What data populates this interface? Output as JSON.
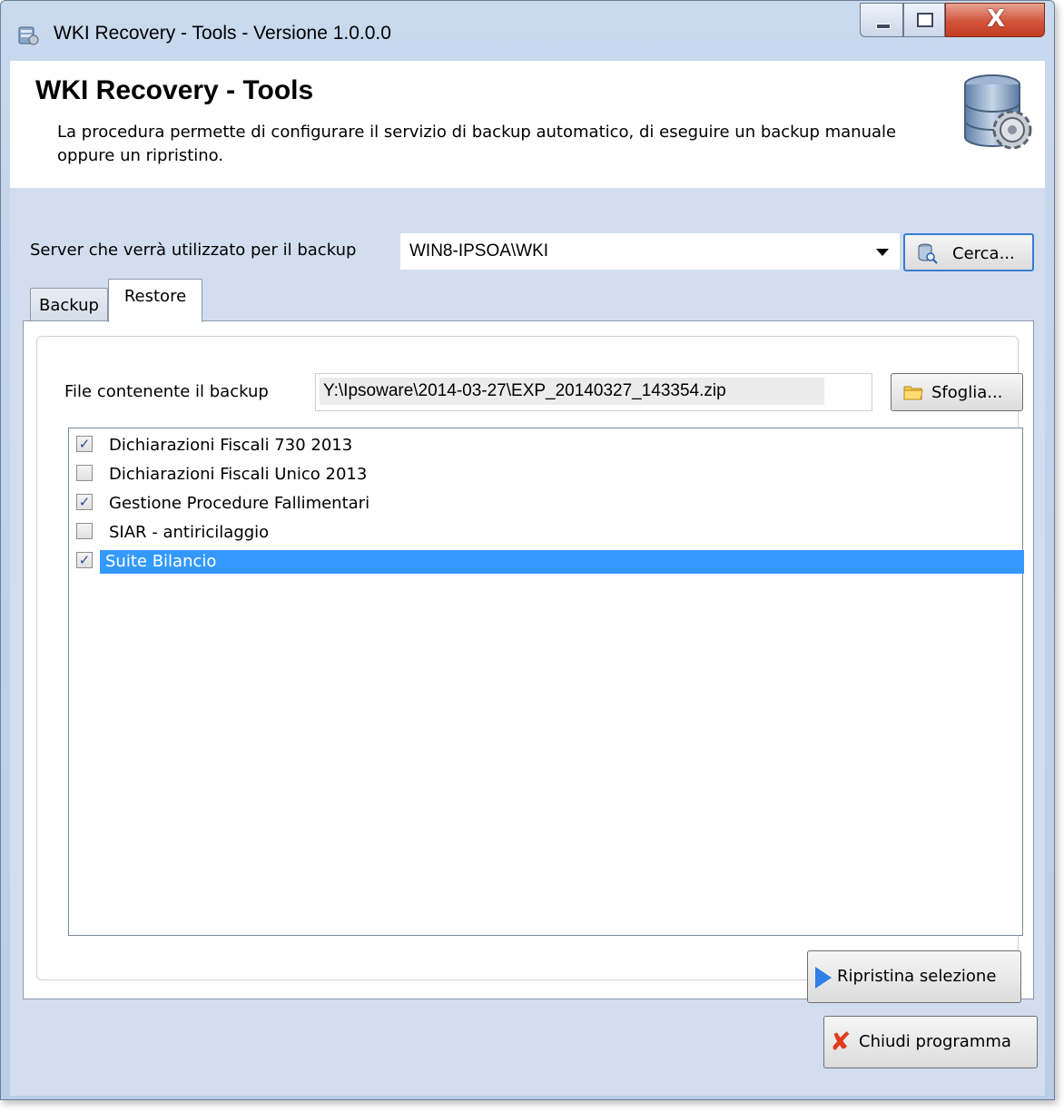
{
  "window": {
    "title": "WKI Recovery - Tools - Versione 1.0.0.0",
    "close_glyph": "X"
  },
  "header": {
    "title": "WKI Recovery - Tools",
    "description": "La procedura permette di configurare il servizio di backup automatico, di eseguire un backup manuale oppure un ripristino."
  },
  "server": {
    "label": "Server che verrà utilizzato per il backup",
    "value": "WIN8-IPSOA\\WKI",
    "search_button": "Cerca..."
  },
  "tabs": [
    {
      "label": "Backup",
      "active": false
    },
    {
      "label": "Restore",
      "active": true
    }
  ],
  "restore": {
    "file_label": "File contenente il backup",
    "file_value": "Y:\\Ipsoware\\2014-03-27\\EXP_20140327_143354.zip",
    "browse_button": "Sfoglia...",
    "items": [
      {
        "label": "Dichiarazioni Fiscali 730 2013",
        "checked": true
      },
      {
        "label": "Dichiarazioni Fiscali Unico 2013",
        "checked": false
      },
      {
        "label": "Gestione Procedure Fallimentari",
        "checked": true
      },
      {
        "label": "SIAR - antiricilaggio",
        "checked": false
      },
      {
        "label": "Suite Bilancio",
        "checked": true,
        "selected": true
      }
    ],
    "restore_button": "Ripristina selezione"
  },
  "footer": {
    "close_button": "Chiudi programma"
  },
  "colors": {
    "selection": "#3399ff",
    "client_bg": "#d2deef",
    "play_icon": "#2f7fe6",
    "close_icon": "#e23a1d"
  },
  "check_glyph": "✓"
}
